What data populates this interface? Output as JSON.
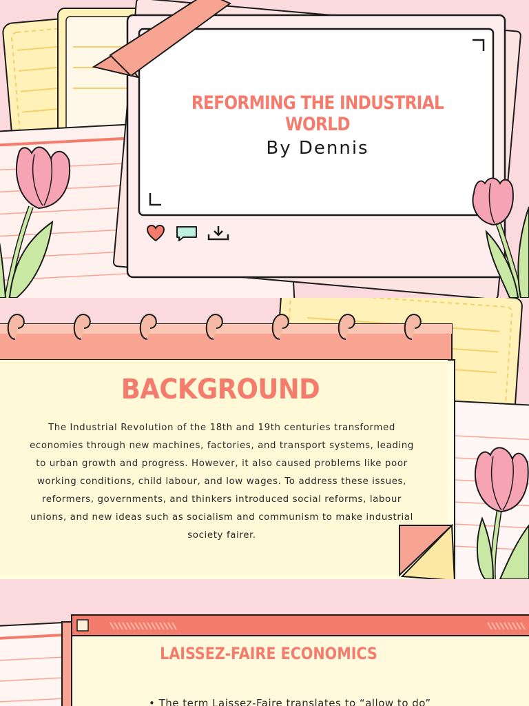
{
  "slides": [
    {
      "title": "REFORMING THE INDUSTRIAL WORLD",
      "subtitle": "By Dennis",
      "icons": [
        "heart-icon",
        "comment-icon",
        "download-icon"
      ]
    },
    {
      "title": "BACKGROUND",
      "body": "The Industrial Revolution of the 18th and 19th centuries transformed economies through new machines, factories, and transport systems, leading to urban growth and progress. However, it also caused problems like poor working conditions, child labour, and low wages. To address these issues, reformers, governments, and thinkers introduced social reforms, labour unions, and new ideas such as socialism and communism to make industrial society fairer."
    },
    {
      "title": "LAISSEZ-FAIRE ECONOMICS",
      "bullet": "• The term Laissez-Faire translates to “allow to do”"
    }
  ],
  "colors": {
    "background": "#fadadd",
    "accent": "#f47c6c",
    "coral": "#f8a493",
    "cream": "#fff7dc",
    "paper_yellow": "#fff1b8",
    "tulip": "#f6a3b4",
    "leaf": "#c9e8a4",
    "comment_icon": "#bdf0dc"
  }
}
